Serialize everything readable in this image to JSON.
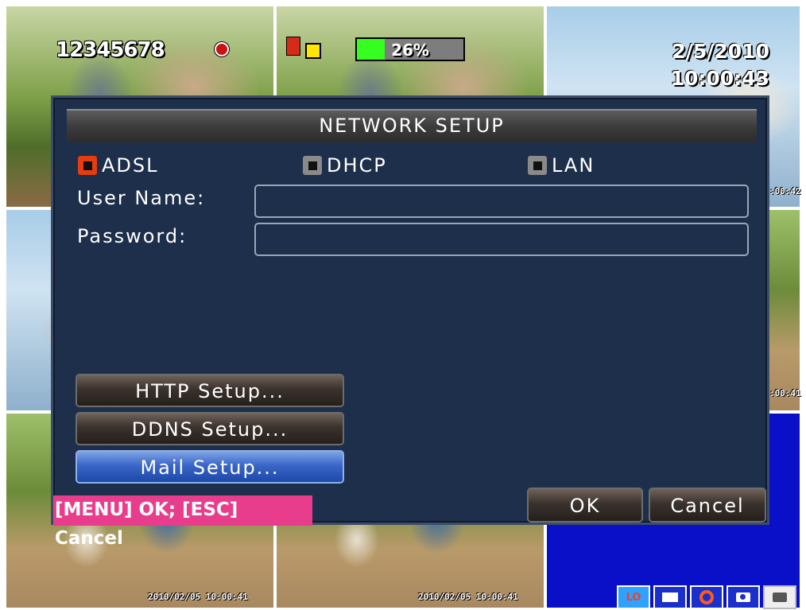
{
  "status": {
    "channels": "12345678",
    "progress_percent": 26,
    "progress_label": "26%",
    "date": "2/5/2010",
    "time": "10:00:43"
  },
  "cameras": {
    "ts_right_top": ":00:42",
    "ts_right_mid": ":00:41",
    "ts_bottom_left": "2010/02/05  10:00:41",
    "ts_bottom_mid": "2010/02/05  10:00:41"
  },
  "dialog": {
    "title": "NETWORK SETUP",
    "modes": [
      {
        "label": "ADSL",
        "selected": true
      },
      {
        "label": "DHCP",
        "selected": false
      },
      {
        "label": "LAN",
        "selected": false
      }
    ],
    "username_label": "User Name:",
    "username_value": "",
    "password_label": "Password:",
    "password_value": "",
    "http_button": "HTTP Setup...",
    "ddns_button": "DDNS Setup...",
    "mail_button": "Mail Setup...",
    "help_text": "[MENU] OK; [ESC] Cancel",
    "ok_button": "OK",
    "cancel_button": "Cancel"
  },
  "toolbar": {
    "lo_label": "LO",
    "icons": [
      "lo-icon",
      "screen-icon",
      "record-icon",
      "camera-icon",
      "snapshot-icon"
    ]
  },
  "colors": {
    "dialog_bg": "#1d2f4b",
    "selected_radio": "#e63c10",
    "active_button": "#3a66c8",
    "help_bar": "#e83d8c",
    "progress_fill": "#35ff20"
  }
}
